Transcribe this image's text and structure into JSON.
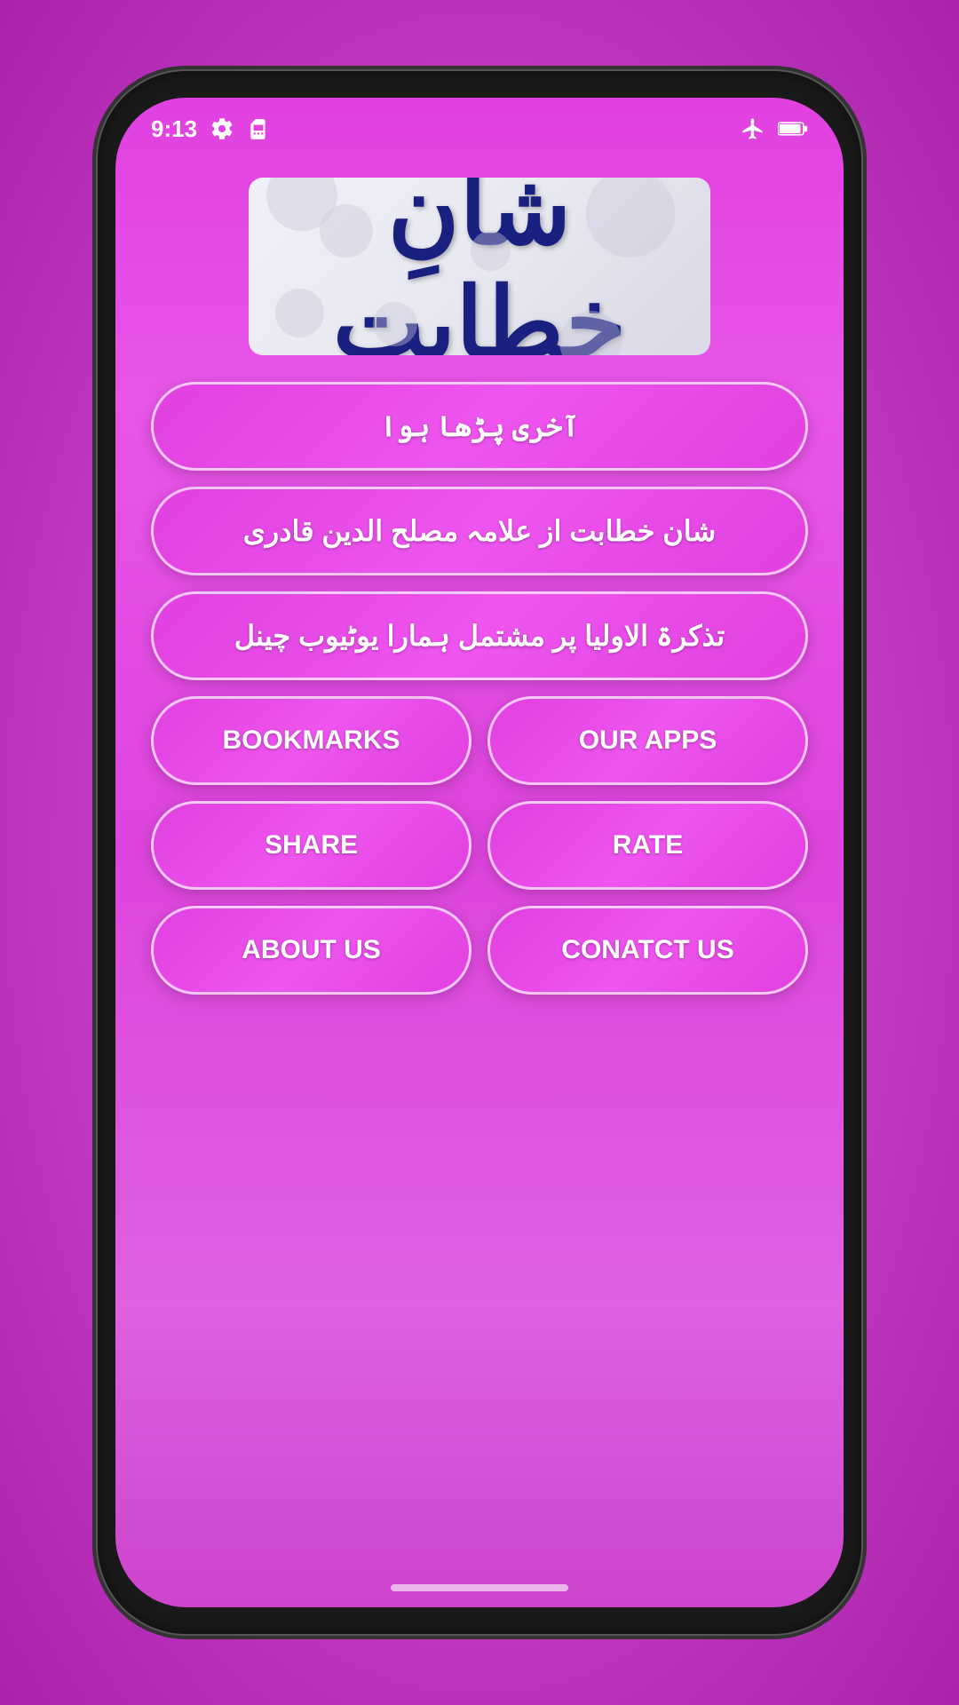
{
  "statusBar": {
    "time": "9:13",
    "icons": [
      "settings-icon",
      "sim-icon",
      "airplane-icon",
      "battery-icon"
    ]
  },
  "app": {
    "logoText": "شانِ خطابت",
    "logoAlt": "Shan e Khitabat"
  },
  "buttons": {
    "lastRead": "آخری پڑھا ہوا",
    "shanKhatabat": "شان خطابت از علامہ مصلح الدین قادری",
    "tazkirahAulia": "تذکرۃ الاولیا پر مشتمل ہمارا یوٹیوب چینل",
    "bookmarks": "BOOKMARKS",
    "ourApps": "OUR APPS",
    "share": "SHARE",
    "rate": "RATE",
    "aboutUs": "ABOUT US",
    "contactUs": "CONATCT US"
  }
}
